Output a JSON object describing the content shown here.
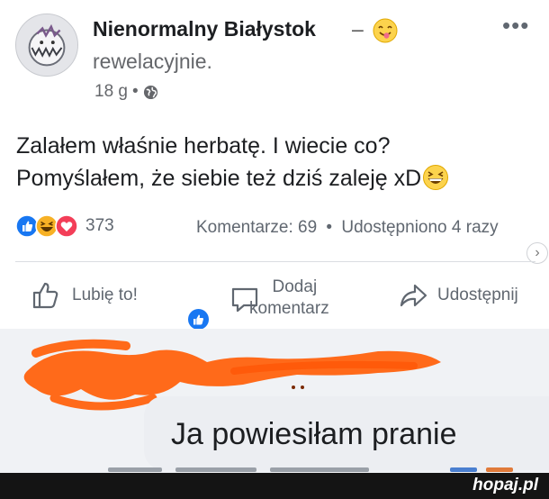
{
  "post": {
    "page_name": "Nienormalny Białystok",
    "feeling_separator": "–",
    "feeling_text": "rewelacyjnie.",
    "feeling_emoji": "smiling-face-with-tongue-icon",
    "time": "18 g",
    "time_separator": "•",
    "privacy": "globe-icon",
    "more_label": "•••",
    "text_line1": "Zalałem właśnie herbatę. I wiecie co?",
    "text_line2": "Pomyślałem, że siebie też dziś zaleję xD",
    "reactions": [
      "like",
      "haha",
      "love"
    ],
    "reaction_count": "373",
    "comments_stat": "Komentarze: 69",
    "stats_separator": "•",
    "shares_stat": "Udostępniono 4 razy"
  },
  "actions": {
    "like_label": "Lubię to!",
    "comment_label_line1": "Dodaj",
    "comment_label_line2": "komentarz",
    "share_label": "Udostępnij"
  },
  "comment": {
    "reply_text": "Ja powiesiłam pranie",
    "redaction_color": "#ff6a1a"
  },
  "watermark": "hopaj.pl",
  "colors": {
    "like_blue": "#1877f2",
    "love_red": "#f33e58",
    "haha_yellow": "#f7b125",
    "meta_gray": "#65676b"
  }
}
